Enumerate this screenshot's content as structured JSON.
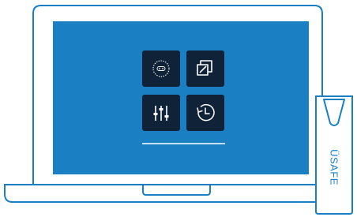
{
  "brand": {
    "label": "ÜSAFE"
  },
  "colors": {
    "outline": "#1b7fc4",
    "screen": "#1a7fc3",
    "tile": "#0f2238",
    "icon": "#ffffff",
    "background": "#ffffff"
  },
  "tiles": [
    {
      "icon": "speedometer-icon"
    },
    {
      "icon": "window-restore-icon"
    },
    {
      "icon": "sliders-icon"
    },
    {
      "icon": "history-clock-icon"
    }
  ]
}
